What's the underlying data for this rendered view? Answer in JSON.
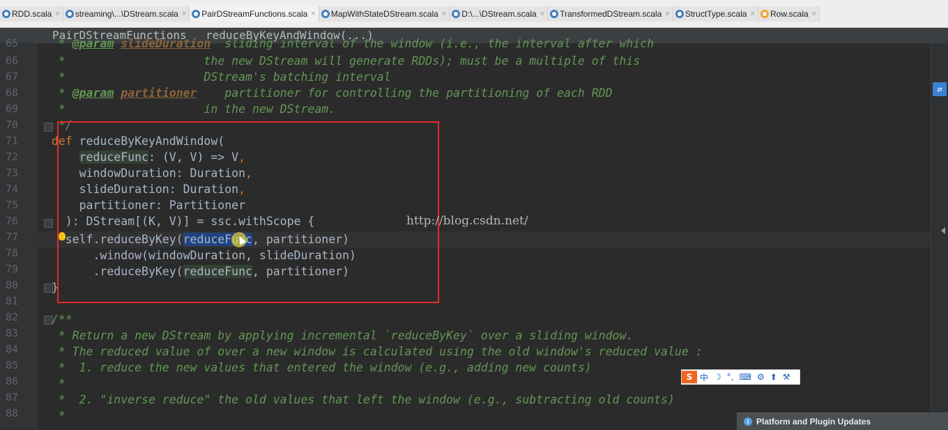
{
  "tabs": [
    {
      "label": "RDD.scala",
      "icon": "scala-class-icon"
    },
    {
      "label": "streaming\\...\\DStream.scala",
      "icon": "scala-class-icon"
    },
    {
      "label": "PairDStreamFunctions.scala",
      "icon": "scala-class-icon",
      "active": true
    },
    {
      "label": "MapWithStateDStream.scala",
      "icon": "scala-class-icon"
    },
    {
      "label": "D:\\...\\DStream.scala",
      "icon": "scala-class-icon"
    },
    {
      "label": "TransformedDStream.scala",
      "icon": "scala-class-icon"
    },
    {
      "label": "StructType.scala",
      "icon": "scala-class-icon"
    },
    {
      "label": "Row.scala",
      "icon": "scala-object-icon"
    }
  ],
  "tab_close_glyph": "×",
  "breadcrumb": [
    "PairDStreamFunctions",
    "reduceByKeyAndWindow(...)"
  ],
  "line_numbers": [
    "65",
    "66",
    "67",
    "68",
    "69",
    "70",
    "71",
    "72",
    "73",
    "74",
    "75",
    "76",
    "77",
    "78",
    "79",
    "80",
    "81",
    "82",
    "83",
    "84",
    "85",
    "86",
    "87",
    "88"
  ],
  "code": {
    "l65a": "   * ",
    "l65b": "@param",
    "l65c": " ",
    "l65d": "slideDuration",
    "l65e": "  sliding interval of the window (i.e., the interval after which",
    "l66": "   *                    the new DStream will generate RDDs); must be a multiple of this",
    "l67": "   *                    DStream's batching interval",
    "l68a": "   * ",
    "l68b": "@param",
    "l68c": " ",
    "l68d": "partitioner",
    "l68e": "    partitioner for controlling the partitioning of each RDD",
    "l69": "   *                    in the new DStream.",
    "l70": "   */",
    "l71a": "  ",
    "l71b": "def",
    "l71c": " reduceByKeyAndWindow(",
    "l72a": "      ",
    "l72b": "reduceFunc",
    "l72c": ": (V, V) => V",
    "l72d": ",",
    "l73a": "      windowDuration: Duration",
    "l73b": ",",
    "l74a": "      slideDuration: Duration",
    "l74b": ",",
    "l75": "      partitioner: Partitioner",
    "l76": "    ): DStream[(K, V)] = ssc.withScope {",
    "l77a": "    self.reduceByKey(",
    "l77b": "reduceFunc",
    "l77c": ", partitioner)",
    "l78": "        .window(windowDuration, slideDuration)",
    "l79a": "        .reduceByKey(",
    "l79b": "reduceFunc",
    "l79c": ", partitioner)",
    "l80": "  }",
    "l81": "",
    "l82": "  /**",
    "l83a": "   * Return a new DStream by applying incremental ",
    "l83b": "`reduceByKey`",
    "l83c": " over a sliding window.",
    "l84": "   * The reduced value of over a new window is calculated using the old window's reduced value :",
    "l85": "   *  1. reduce the new values that entered the window (e.g., adding new counts)",
    "l86": "   *",
    "l87": "   *  2. \"inverse reduce\" the old values that left the window (e.g., subtracting old counts)",
    "l88": "   *"
  },
  "watermark": "http://blog.csdn.net/",
  "ime": {
    "logo": "S",
    "lang": "中",
    "rest": [
      "☽",
      "°,",
      "⌨",
      "⚙",
      "⬆",
      "⚒"
    ]
  },
  "notification": {
    "icon": "i",
    "text": "Platform and Plugin Updates"
  },
  "side_button": "⇄",
  "colors": {
    "keyword": "#cc7832",
    "comment": "#629755",
    "selection": "#214283",
    "highlight_box": "#e8292e"
  }
}
